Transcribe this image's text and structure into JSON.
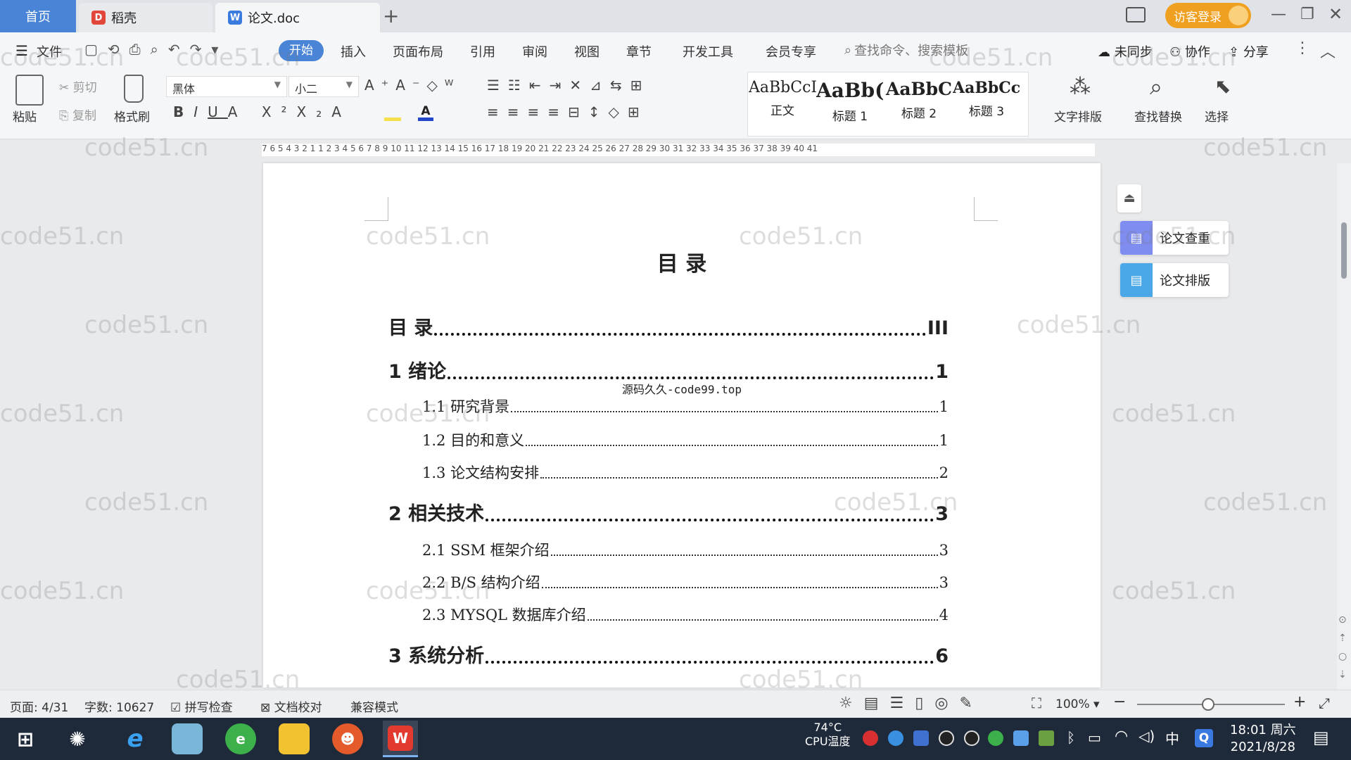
{
  "tabs": {
    "home": "首页",
    "daoke": "稻壳",
    "doc": "论文.doc",
    "new_tab": "+",
    "visitor_login": "访客登录"
  },
  "menu": {
    "file": "文件",
    "start": "开始",
    "insert": "插入",
    "layout": "页面布局",
    "reference": "引用",
    "review": "审阅",
    "view": "视图",
    "chapter": "章节",
    "devtools": "开发工具",
    "member": "会员专享",
    "search_placeholder": "查找命令、搜索模板",
    "unsynced": "未同步",
    "collab": "协作",
    "share": "分享"
  },
  "ribbon": {
    "paste": "粘贴",
    "cut": "剪切",
    "copy": "复制",
    "format_painter": "格式刷",
    "font_name": "黑体",
    "font_size": "小二",
    "styles": [
      {
        "preview": "AaBbCcI",
        "label": "正文"
      },
      {
        "preview": "AaBb(",
        "label": "标题 1"
      },
      {
        "preview": "AaBbC",
        "label": "标题 2"
      },
      {
        "preview": "AaBbCcI",
        "label": "标题 3"
      }
    ],
    "text_layout": "文字排版",
    "find_replace": "查找替换",
    "select": "选择"
  },
  "ruler_text": "7  6  5  4  3  2  1     1  2  3  4  5  6  7  8  9  10  11  12  13  14  15  16  17  18  19  20  21  22  23  24  25  26  27  28  29  30  31  32  33  34  35  36  37  38  39  40  41",
  "document": {
    "title": "目  录",
    "watermark_line": "源码久久-code99.top",
    "toc": [
      {
        "level": 1,
        "text": "目  录",
        "page": "III"
      },
      {
        "level": 1,
        "text": "1  绪论",
        "page": "1"
      },
      {
        "level": 2,
        "text": "1.1  研究背景",
        "page": "1"
      },
      {
        "level": 2,
        "text": "1.2  目的和意义",
        "page": "1"
      },
      {
        "level": 2,
        "text": "1.3  论文结构安排",
        "page": "2"
      },
      {
        "level": 1,
        "text": "2  相关技术",
        "page": "3"
      },
      {
        "level": 2,
        "text": "2.1 SSM 框架介绍",
        "page": "3"
      },
      {
        "level": 2,
        "text": "2.2 B/S 结构介绍",
        "page": "3"
      },
      {
        "level": 2,
        "text": "2.3 MYSQL 数据库介绍",
        "page": "4"
      },
      {
        "level": 1,
        "text": "3  系统分析",
        "page": "6"
      }
    ]
  },
  "side_panel": {
    "check": "论文查重",
    "format": "论文排版"
  },
  "status": {
    "page": "页面: 4/31",
    "words": "字数: 10627",
    "spell": "拼写检查",
    "proof": "文档校对",
    "compat": "兼容模式",
    "zoom": "100%"
  },
  "taskbar": {
    "cpu_temp": "74°C",
    "cpu_label": "CPU温度",
    "ime": "中",
    "time": "18:01 周六",
    "date": "2021/8/28"
  },
  "watermark": "code51.cn",
  "colors": {
    "accent": "#4a84d6",
    "visitor": "#f0a020",
    "taskbar": "#1e2a3a"
  }
}
